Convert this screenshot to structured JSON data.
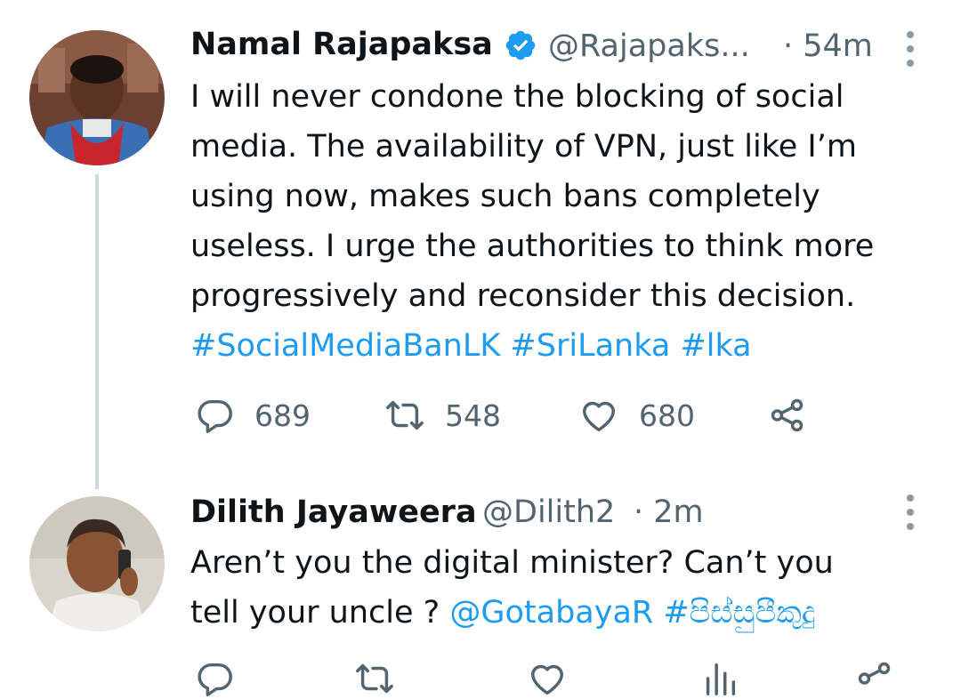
{
  "tweet1": {
    "author_name": "Namal Rajapaksa",
    "handle": "@Rajapaks...",
    "time": "· 54m",
    "lines": [
      "I will never condone the blocking of social",
      "media. The availability of VPN, just like I’m",
      "using now, makes such bans completely",
      "useless. I urge the authorities to think more",
      "progressively and reconsider this decision."
    ],
    "hashtags": "#SocialMediaBanLK #SriLanka #lka",
    "reply_count": "689",
    "retweet_count": "548",
    "like_count": "680"
  },
  "tweet2": {
    "author_name": "Dilith Jayaweera",
    "handle": "@Dilith2",
    "time": "· 2m",
    "lines": [
      "Aren’t you the digital minister? Can’t you",
      "tell your uncle ? "
    ],
    "mention_tags": "@GotabayaR #පිස්සුපීකුදු"
  },
  "colors": {
    "link": "#1d9bf0",
    "secondary_text": "#536471",
    "thread_line": "#cfd9de",
    "verified": "#1d9bf0"
  },
  "icons": [
    "verified-badge-icon",
    "more-icon",
    "reply-icon",
    "retweet-icon",
    "like-icon",
    "share-icon"
  ]
}
